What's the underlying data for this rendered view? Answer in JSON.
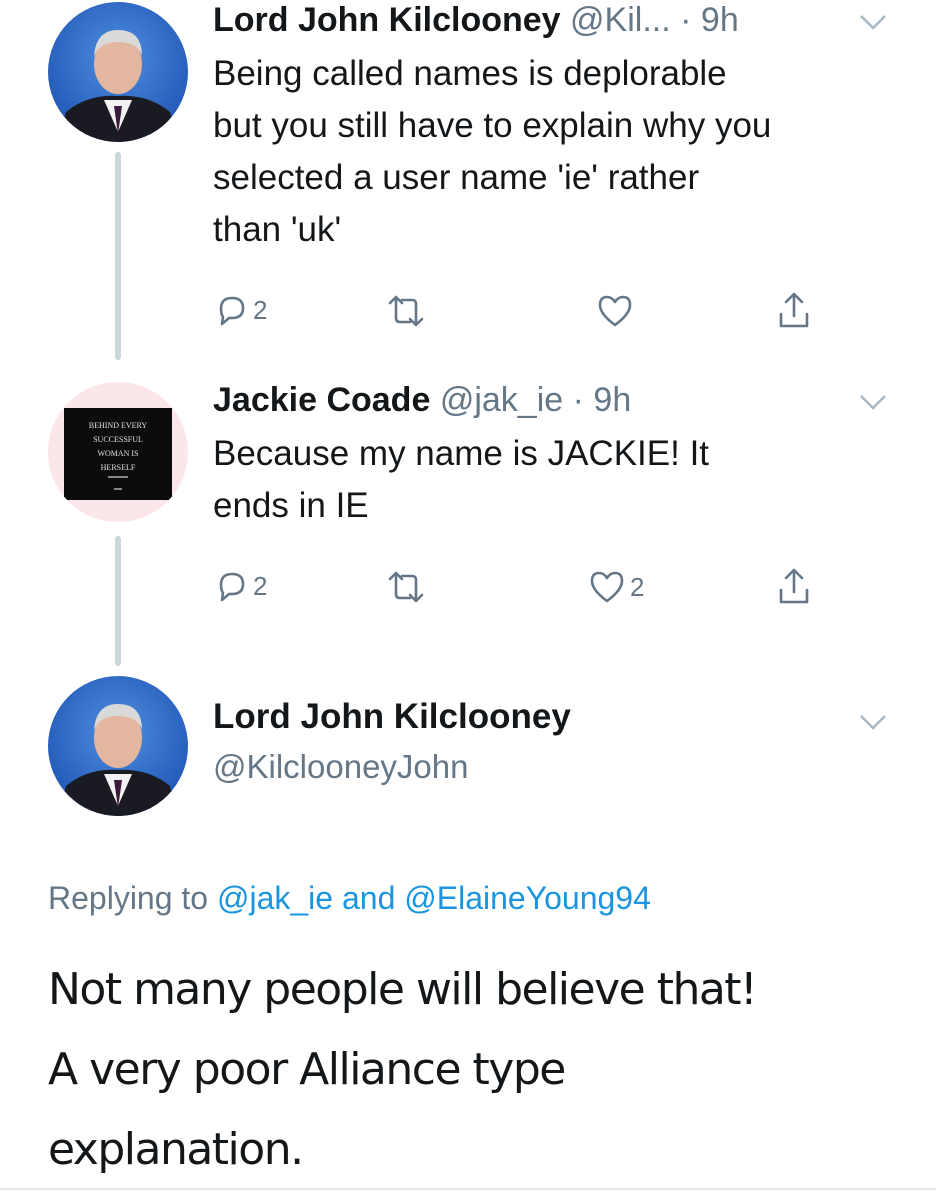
{
  "tweets": [
    {
      "display_name": "Lord John Kilclooney",
      "handle": "@Kil...",
      "separator": "·",
      "time": "9h",
      "text_lines": [
        "Being called names is deplorable",
        "but you still have to explain why you",
        "selected a user name 'ie' rather",
        "than 'uk'"
      ],
      "actions": {
        "reply_count": "2",
        "retweet_count": "",
        "like_count": ""
      }
    },
    {
      "display_name": "Jackie Coade",
      "handle": "@jak_ie",
      "separator": "·",
      "time": "9h",
      "avatar_text": [
        "BEHIND EVERY",
        "SUCCESSFUL",
        "WOMAN IS",
        "HERSELF"
      ],
      "text_lines": [
        "Because my name is JACKIE! It",
        "ends in IE"
      ],
      "actions": {
        "reply_count": "2",
        "retweet_count": "",
        "like_count": "2"
      }
    }
  ],
  "main_tweet": {
    "display_name": "Lord John Kilclooney",
    "handle": "@KilclooneyJohn",
    "replying_prefix": "Replying to",
    "replying_user_1": "@jak_ie",
    "replying_and": "and",
    "replying_user_2": "@ElaineYoung94",
    "text_lines": [
      "Not many people will believe that!",
      "A very poor Alliance type",
      "explanation."
    ]
  },
  "icons": {
    "reply": "reply-icon",
    "retweet": "retweet-icon",
    "like": "heart-icon",
    "share": "share-icon",
    "menu": "chevron-down-icon"
  },
  "colors": {
    "text": "#14171a",
    "secondary": "#657786",
    "link": "#1b95e0",
    "thread_line": "#ccd6dd"
  }
}
